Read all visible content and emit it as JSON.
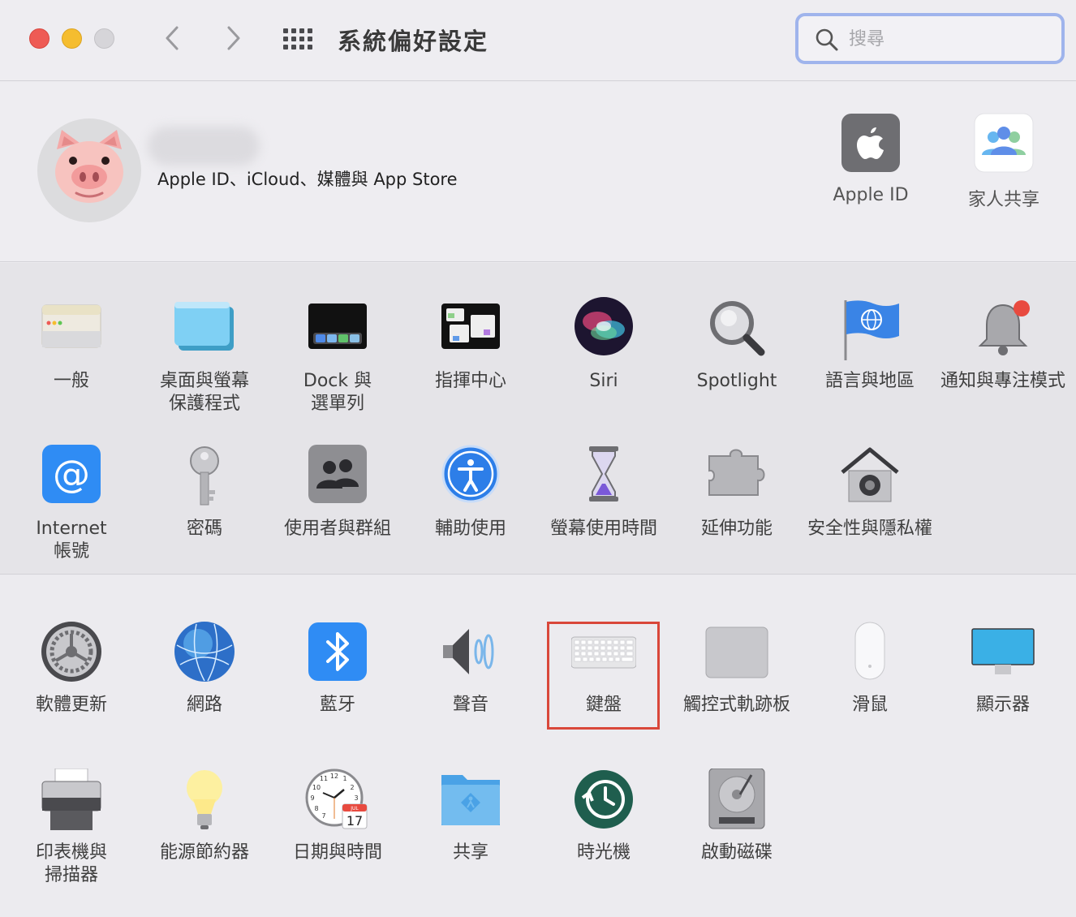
{
  "window": {
    "title": "系統偏好設定",
    "search_placeholder": "搜尋"
  },
  "account": {
    "subtitle": "Apple ID、iCloud、媒體與 App Store",
    "top_items": [
      {
        "label": "Apple ID",
        "icon": "apple-logo-icon"
      },
      {
        "label": "家人共享",
        "icon": "family-sharing-icon"
      }
    ]
  },
  "sections": {
    "personal": [
      {
        "label": "一般",
        "icon": "general-icon"
      },
      {
        "label": "桌面與螢幕\n保護程式",
        "icon": "desktop-screensaver-icon"
      },
      {
        "label": "Dock 與\n選單列",
        "icon": "dock-icon"
      },
      {
        "label": "指揮中心",
        "icon": "mission-control-icon"
      },
      {
        "label": "Siri",
        "icon": "siri-icon"
      },
      {
        "label": "Spotlight",
        "icon": "spotlight-icon"
      },
      {
        "label": "語言與地區",
        "icon": "globe-flag-icon"
      },
      {
        "label": "通知與專注模式",
        "icon": "bell-icon"
      },
      {
        "label": "Internet\n帳號",
        "icon": "at-sign-icon"
      },
      {
        "label": "密碼",
        "icon": "key-icon"
      },
      {
        "label": "使用者與群組",
        "icon": "users-icon"
      },
      {
        "label": "輔助使用",
        "icon": "accessibility-icon"
      },
      {
        "label": "螢幕使用時間",
        "icon": "hourglass-icon"
      },
      {
        "label": "延伸功能",
        "icon": "puzzle-icon"
      },
      {
        "label": "安全性與隱私權",
        "icon": "house-lock-icon"
      }
    ],
    "hardware": [
      {
        "label": "軟體更新",
        "icon": "software-update-gear-icon"
      },
      {
        "label": "網路",
        "icon": "network-globe-icon"
      },
      {
        "label": "藍牙",
        "icon": "bluetooth-icon"
      },
      {
        "label": "聲音",
        "icon": "speaker-icon"
      },
      {
        "label": "鍵盤",
        "icon": "keyboard-icon"
      },
      {
        "label": "觸控式軌跡板",
        "icon": "trackpad-icon"
      },
      {
        "label": "滑鼠",
        "icon": "mouse-icon"
      },
      {
        "label": "顯示器",
        "icon": "display-icon"
      },
      {
        "label": "印表機與\n掃描器",
        "icon": "printer-icon"
      },
      {
        "label": "能源節約器",
        "icon": "lightbulb-icon"
      },
      {
        "label": "日期與時間",
        "icon": "clock-calendar-icon"
      },
      {
        "label": "共享",
        "icon": "shared-folder-icon"
      },
      {
        "label": "時光機",
        "icon": "time-machine-icon"
      },
      {
        "label": "啟動磁碟",
        "icon": "hard-disk-icon"
      }
    ]
  },
  "calendar_badge": {
    "month": "JUL",
    "day": "17"
  },
  "clock_numbers": {
    "n12": "12",
    "n11": "11",
    "n1": "1",
    "n10": "10",
    "n2": "2",
    "n9": "9",
    "n3": "3",
    "n8": "8",
    "n7": "7"
  },
  "highlighted_item": "鍵盤",
  "colors": {
    "accent": "#3478f6",
    "highlight_border": "#d9473a",
    "search_ring": "#9fb4ec"
  }
}
